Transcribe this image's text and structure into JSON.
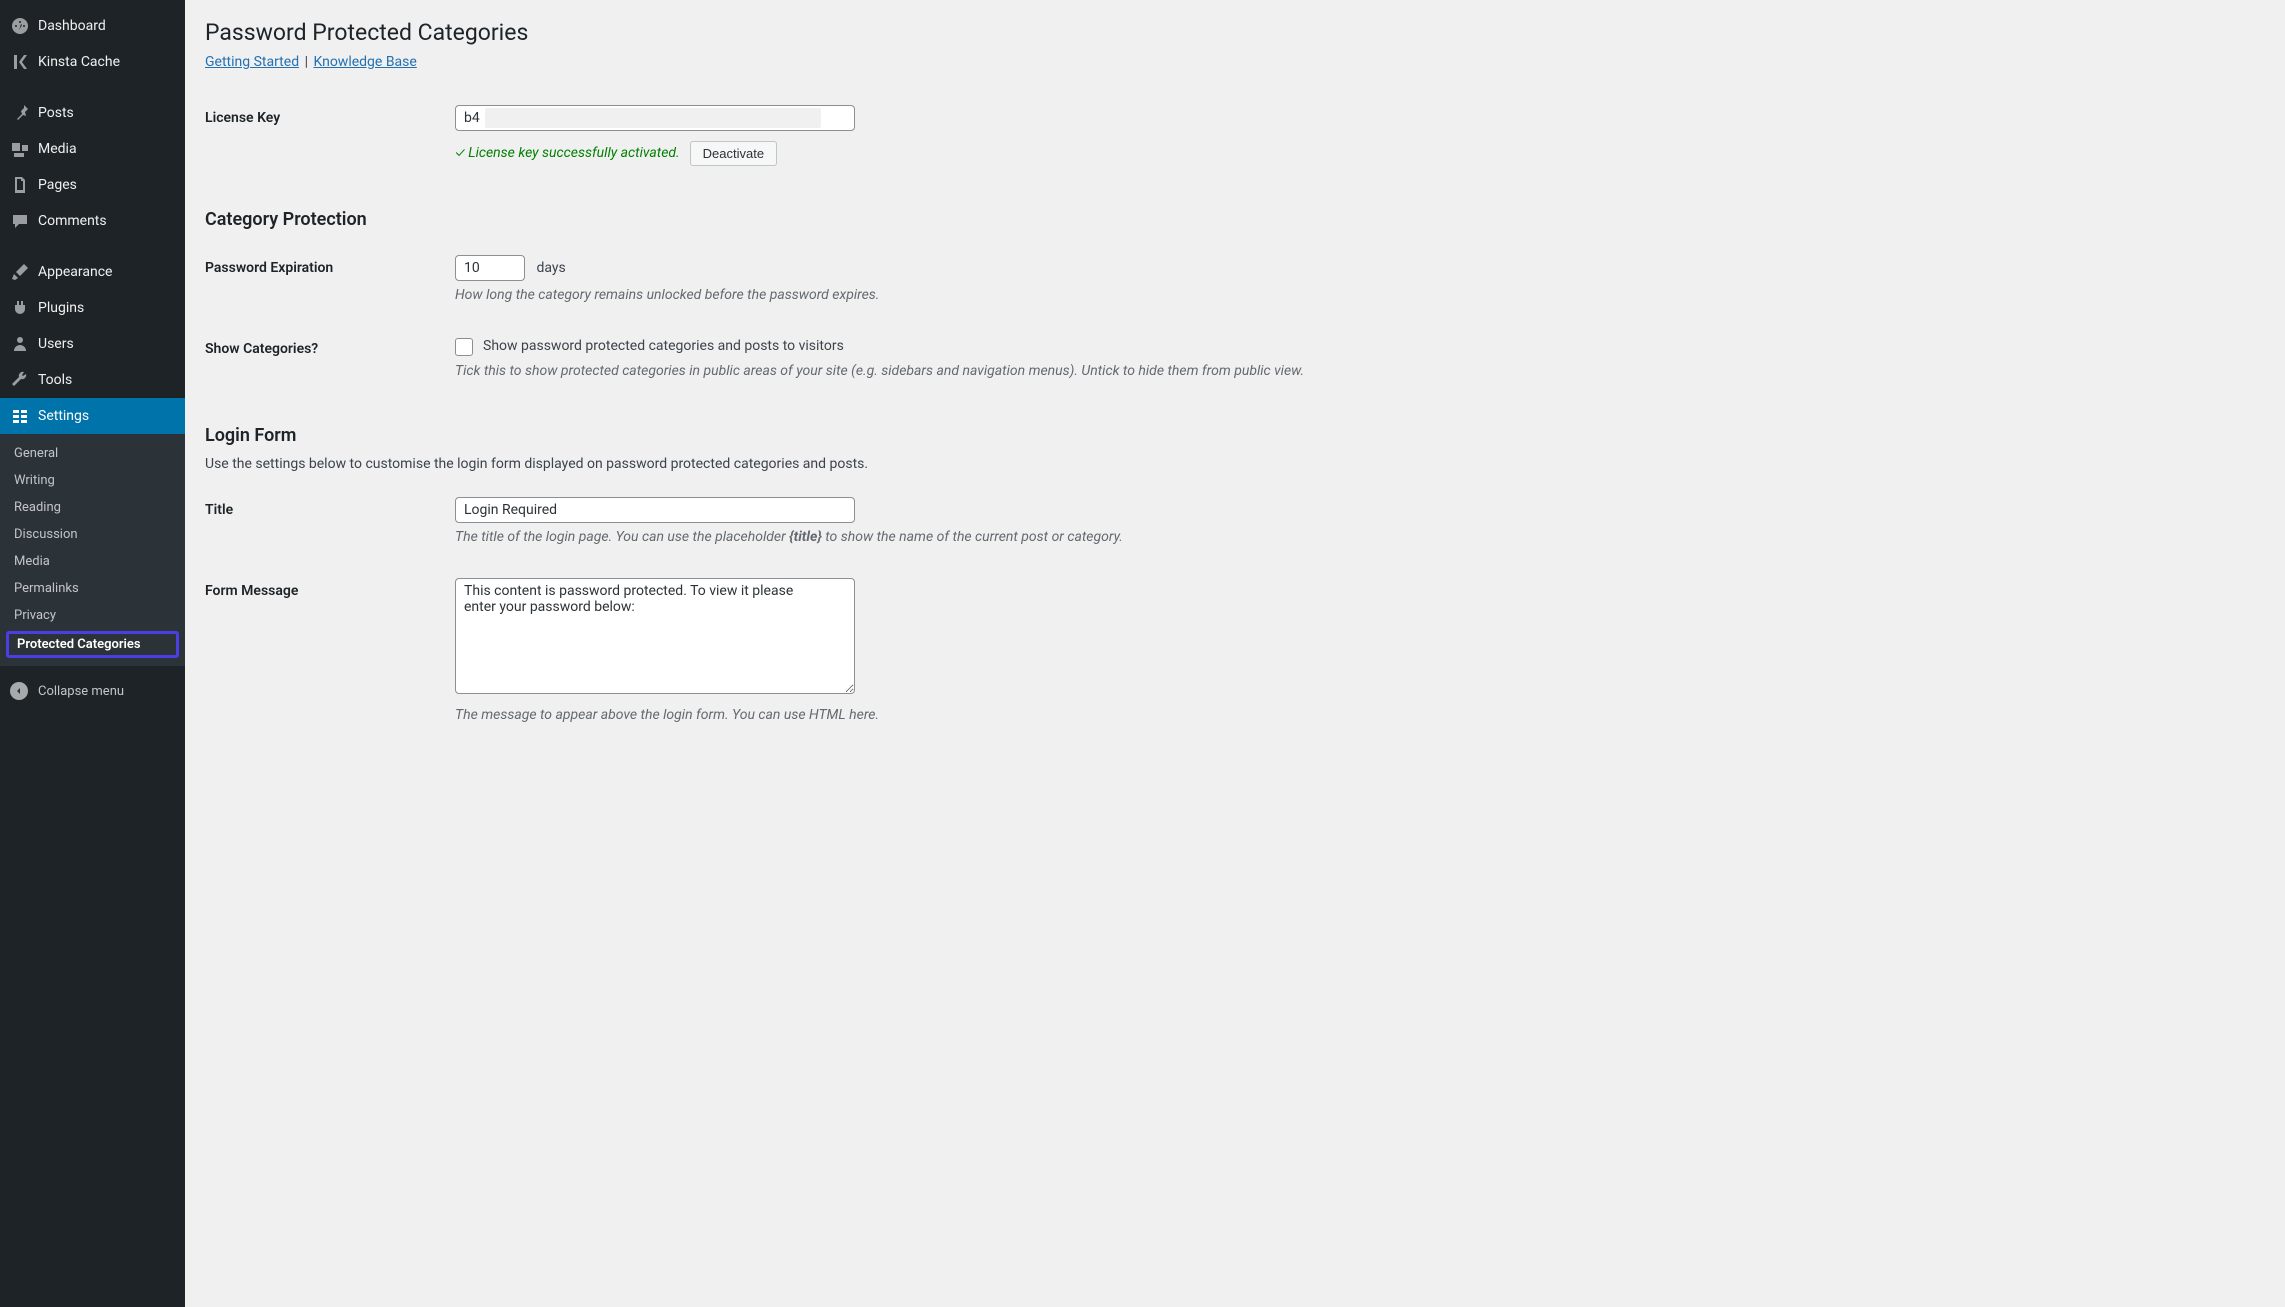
{
  "sidebar": {
    "items": [
      {
        "label": "Dashboard",
        "icon": "dashboard"
      },
      {
        "label": "Kinsta Cache",
        "icon": "kinsta"
      }
    ],
    "items2": [
      {
        "label": "Posts",
        "icon": "pin"
      },
      {
        "label": "Media",
        "icon": "media"
      },
      {
        "label": "Pages",
        "icon": "pages"
      },
      {
        "label": "Comments",
        "icon": "comments"
      }
    ],
    "items3": [
      {
        "label": "Appearance",
        "icon": "brush"
      },
      {
        "label": "Plugins",
        "icon": "plug"
      },
      {
        "label": "Users",
        "icon": "users"
      },
      {
        "label": "Tools",
        "icon": "wrench"
      },
      {
        "label": "Settings",
        "icon": "settings",
        "current": true
      }
    ],
    "submenu": [
      {
        "label": "General"
      },
      {
        "label": "Writing"
      },
      {
        "label": "Reading"
      },
      {
        "label": "Discussion"
      },
      {
        "label": "Media"
      },
      {
        "label": "Permalinks"
      },
      {
        "label": "Privacy"
      },
      {
        "label": "Protected Categories",
        "current": true
      }
    ],
    "collapse_label": "Collapse menu"
  },
  "page": {
    "title": "Password Protected Categories",
    "links": {
      "getting_started": "Getting Started",
      "knowledge_base": "Knowledge Base"
    },
    "license": {
      "label": "License Key",
      "value": "b4                                                                  ba",
      "success_msg": "✓ License key successfully activated.",
      "deactivate_btn": "Deactivate"
    },
    "section_protection": "Category Protection",
    "expiration": {
      "label": "Password Expiration",
      "value": "10",
      "unit": "days",
      "desc": "How long the category remains unlocked before the password expires."
    },
    "show_cats": {
      "label": "Show Categories?",
      "checkbox_label": "Show password protected categories and posts to visitors",
      "desc": "Tick this to show protected categories in public areas of your site (e.g. sidebars and navigation menus). Untick to hide them from public view."
    },
    "section_login": "Login Form",
    "login_intro": "Use the settings below to customise the login form displayed on password protected categories and posts.",
    "title_field": {
      "label": "Title",
      "value": "Login Required",
      "desc_pre": "The title of the login page. You can use the placeholder ",
      "desc_tag": "{title}",
      "desc_post": " to show the name of the current post or category."
    },
    "message_field": {
      "label": "Form Message",
      "value": "This content is password protected. To view it please\nenter your password below:",
      "desc": "The message to appear above the login form. You can use HTML here."
    }
  }
}
